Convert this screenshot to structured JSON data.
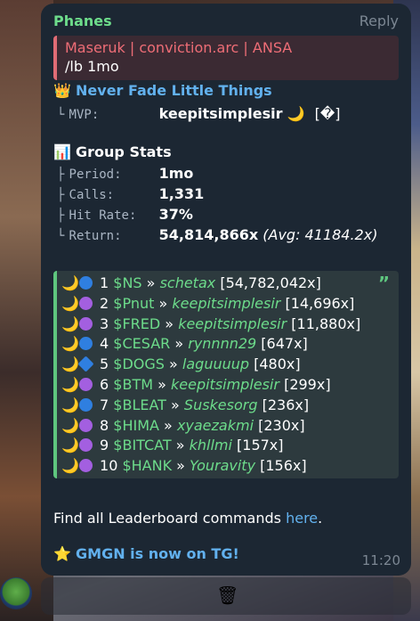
{
  "message": {
    "sender": "Phanes",
    "reply_label": "Reply",
    "quote_author": "Maseruk | conviction.arc | ANSA",
    "quote_text": "/lb 1mo",
    "mvp_heading": "Never Fade Little Things",
    "mvp_label": "MVP:",
    "mvp_value": "keepitsimplesir",
    "mvp_suffix": "[�]",
    "stats_heading": "Group Stats",
    "stats": [
      {
        "label": "Period:",
        "value": "1mo"
      },
      {
        "label": "Calls:",
        "value": "1,331"
      },
      {
        "label": "Hit Rate:",
        "value": "37%"
      },
      {
        "label": "Return:",
        "value": "54,814,866x",
        "extra": "(Avg: 41184.2x)"
      }
    ],
    "leaderboard": [
      {
        "rank": "1",
        "token": "$NS",
        "user": "schetax",
        "mult": "[54,782,042x]",
        "badge": "blue-dot"
      },
      {
        "rank": "2",
        "token": "$Pnut",
        "user": "keepitsimplesir",
        "mult": "[14,696x]",
        "badge": "purple-dot"
      },
      {
        "rank": "3",
        "token": "$FRED",
        "user": "keepitsimplesir",
        "mult": "[11,880x]",
        "badge": "purple-dot"
      },
      {
        "rank": "4",
        "token": "$CESAR",
        "user": "rynnnn29",
        "mult": "[647x]",
        "badge": "blue-dot"
      },
      {
        "rank": "5",
        "token": "$DOGS",
        "user": "laguuuup",
        "mult": "[480x]",
        "badge": "blue-diamond"
      },
      {
        "rank": "6",
        "token": "$BTM",
        "user": "keepitsimplesir",
        "mult": "[299x]",
        "badge": "purple-dot"
      },
      {
        "rank": "7",
        "token": "$BLEAT",
        "user": "Suskesorg",
        "mult": "[236x]",
        "badge": "blue-dot"
      },
      {
        "rank": "8",
        "token": "$HIMA",
        "user": "xyaezakmi",
        "mult": "[230x]",
        "badge": "purple-dot"
      },
      {
        "rank": "9",
        "token": "$BITCAT",
        "user": "khllmi",
        "mult": "[157x]",
        "badge": "purple-dot"
      },
      {
        "rank": "10",
        "token": "$HANK",
        "user": "Youravity",
        "mult": "[156x]",
        "badge": "purple-dot"
      }
    ],
    "footer_text": "Find all Leaderboard commands",
    "footer_link": "here",
    "promo": "GMGN is now on TG!",
    "time": "11:20"
  },
  "colors": {
    "bubble": "#1c2733",
    "sender": "#6ddc8b",
    "link": "#62b1ee",
    "quote_author": "#ee6d76"
  }
}
